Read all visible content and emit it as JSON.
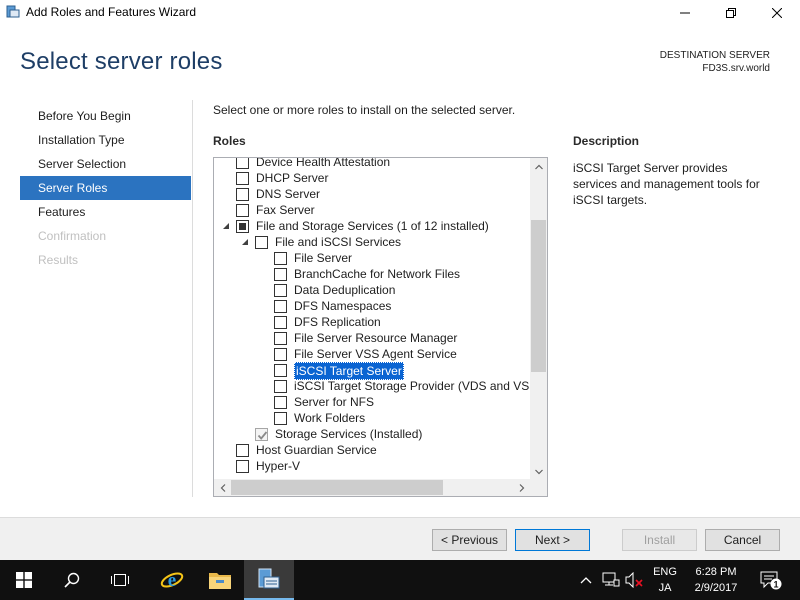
{
  "window": {
    "title": "Add Roles and Features Wizard",
    "minimize_icon": "minimize-icon",
    "maximize_icon": "maximize-icon",
    "close_icon": "close-icon"
  },
  "header": {
    "page_title": "Select server roles",
    "destination_label": "DESTINATION SERVER",
    "destination_server": "FD3S.srv.world"
  },
  "nav": {
    "items": [
      {
        "label": "Before You Begin",
        "state": "normal"
      },
      {
        "label": "Installation Type",
        "state": "normal"
      },
      {
        "label": "Server Selection",
        "state": "normal"
      },
      {
        "label": "Server Roles",
        "state": "active"
      },
      {
        "label": "Features",
        "state": "normal"
      },
      {
        "label": "Confirmation",
        "state": "disabled"
      },
      {
        "label": "Results",
        "state": "disabled"
      }
    ]
  },
  "main": {
    "instruction": "Select one or more roles to install on the selected server.",
    "roles_label": "Roles",
    "description_label": "Description",
    "description_text": "iSCSI Target Server provides services and management tools for iSCSI targets."
  },
  "roles": [
    {
      "label": "Device Health Attestation",
      "level": 0,
      "state": "unchecked",
      "clipped": true
    },
    {
      "label": "DHCP Server",
      "level": 0,
      "state": "unchecked"
    },
    {
      "label": "DNS Server",
      "level": 0,
      "state": "unchecked"
    },
    {
      "label": "Fax Server",
      "level": 0,
      "state": "unchecked"
    },
    {
      "label": "File and Storage Services (1 of 12 installed)",
      "level": 0,
      "state": "partial",
      "expanded": true
    },
    {
      "label": "File and iSCSI Services",
      "level": 1,
      "state": "unchecked",
      "expanded": true
    },
    {
      "label": "File Server",
      "level": 2,
      "state": "unchecked"
    },
    {
      "label": "BranchCache for Network Files",
      "level": 2,
      "state": "unchecked"
    },
    {
      "label": "Data Deduplication",
      "level": 2,
      "state": "unchecked"
    },
    {
      "label": "DFS Namespaces",
      "level": 2,
      "state": "unchecked"
    },
    {
      "label": "DFS Replication",
      "level": 2,
      "state": "unchecked"
    },
    {
      "label": "File Server Resource Manager",
      "level": 2,
      "state": "unchecked"
    },
    {
      "label": "File Server VSS Agent Service",
      "level": 2,
      "state": "unchecked"
    },
    {
      "label": "iSCSI Target Server",
      "level": 2,
      "state": "unchecked",
      "selected": true
    },
    {
      "label": "iSCSI Target Storage Provider (VDS and VSS h",
      "level": 2,
      "state": "unchecked"
    },
    {
      "label": "Server for NFS",
      "level": 2,
      "state": "unchecked"
    },
    {
      "label": "Work Folders",
      "level": 2,
      "state": "unchecked"
    },
    {
      "label": "Storage Services (Installed)",
      "level": 1,
      "state": "checked-disabled"
    },
    {
      "label": "Host Guardian Service",
      "level": 0,
      "state": "unchecked"
    },
    {
      "label": "Hyper-V",
      "level": 0,
      "state": "unchecked"
    }
  ],
  "footer": {
    "previous": "< Previous",
    "next": "Next >",
    "install": "Install",
    "cancel": "Cancel"
  },
  "taskbar": {
    "lang_line1": "ENG",
    "lang_line2": "JA",
    "time": "6:28 PM",
    "date": "2/9/2017",
    "notification_count": "1"
  },
  "colors": {
    "accent": "#2b73c0",
    "title": "#1e3e66",
    "selection": "#0a64d2",
    "taskbar": "#101010"
  }
}
